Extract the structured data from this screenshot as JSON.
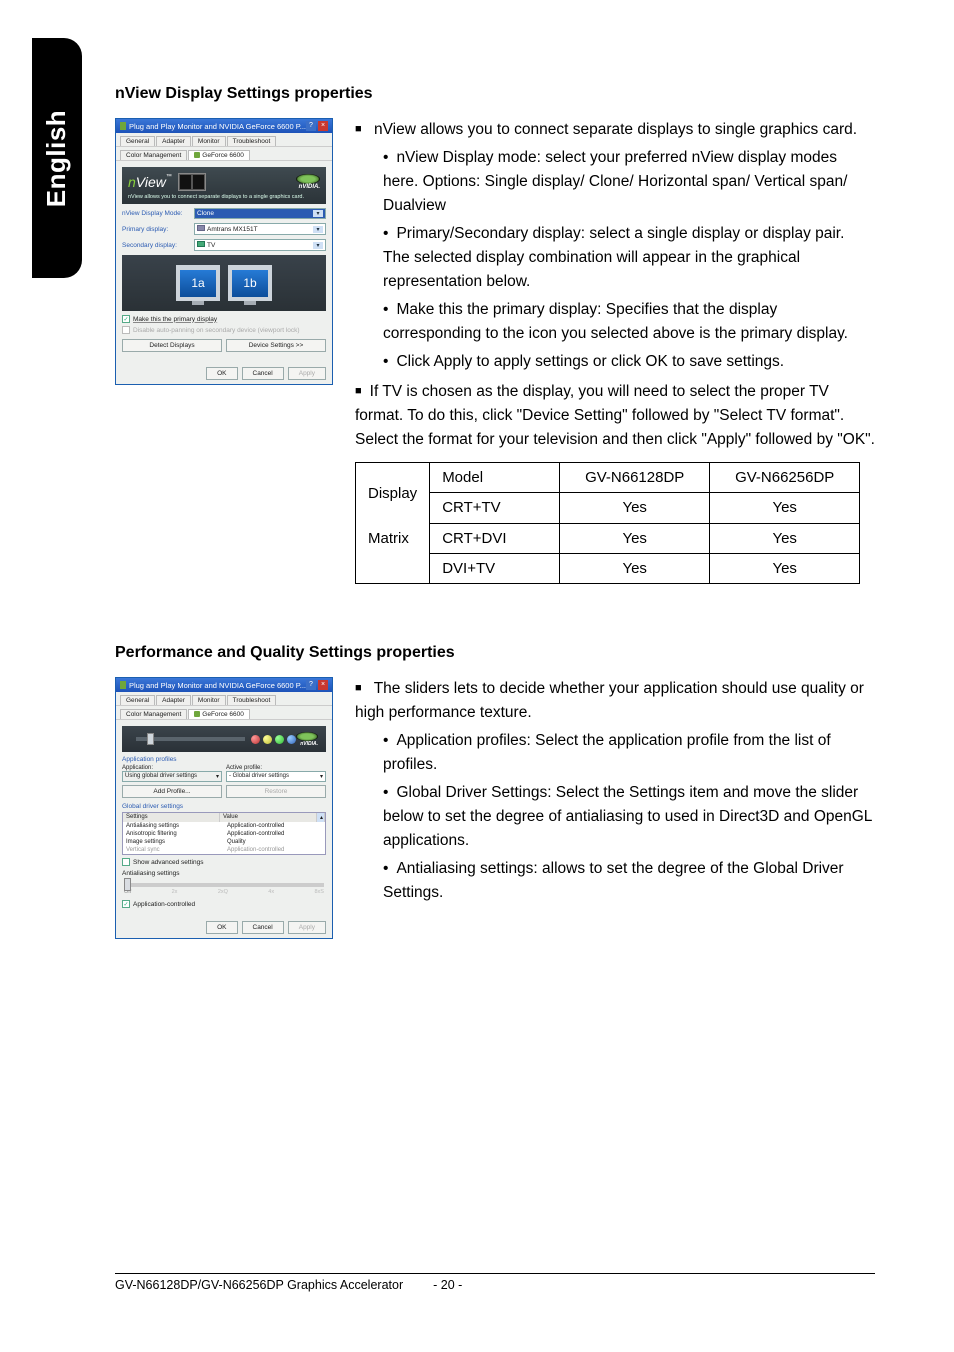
{
  "side_tab": "English",
  "sections": {
    "nview": {
      "heading": "nView Display Settings properties",
      "dialog": {
        "title": "Plug and Play Monitor and NVIDIA GeForce 6600 P...",
        "tabs_row1": [
          "General",
          "Adapter",
          "Monitor",
          "Troubleshoot"
        ],
        "tabs_row2": [
          "Color Management",
          "GeForce 6600"
        ],
        "banner_logo": {
          "prefix": "n",
          "rest": "View",
          "tm": "™"
        },
        "banner_brand": "nVIDIA.",
        "banner_caption": "nView allows you to connect separate displays to a single graphics card.",
        "rows": {
          "mode_label": "nView Display Mode:",
          "mode_value": "Clone",
          "primary_label": "Primary display:",
          "primary_value": "Amtrans MX151T",
          "secondary_label": "Secondary display:",
          "secondary_value": "TV"
        },
        "monitors": [
          "1a",
          "1b"
        ],
        "check1": "Make this the primary display",
        "check2": "Disable auto-panning on secondary device (viewport lock)",
        "btn_detect": "Detect Displays",
        "btn_device": "Device Settings >>",
        "footer": {
          "ok": "OK",
          "cancel": "Cancel",
          "apply": "Apply"
        }
      },
      "bullets": {
        "top1": "nView allows you to connect separate displays to single graphics card.",
        "sub1": "nView Display mode: select your preferred nView display modes here. Options: Single display/ Clone/ Horizontal span/ Vertical span/ Dualview",
        "sub2": "Primary/Secondary display: select a single display or display pair. The selected display combination will appear in the graphical representation below.",
        "sub3": "Make this the primary display: Specifies that the display corresponding to the icon you selected above is the primary display.",
        "sub4": "Click Apply to apply settings or click OK to save settings.",
        "top2": "If TV is chosen as the display,  you will need to select the proper TV format.  To do this, click \"Device Setting\" followed by \"Select TV format\". Select the format for your television and then click \"Apply\" followed by \"OK\"."
      },
      "table": {
        "h_display": "Display",
        "h_matrix": "Matrix",
        "h_model": "Model",
        "h_c1": "GV-N66128DP",
        "h_c2": "GV-N66256DP",
        "rows": [
          {
            "model": "CRT+TV",
            "c1": "Yes",
            "c2": "Yes"
          },
          {
            "model": "CRT+DVI",
            "c1": "Yes",
            "c2": "Yes"
          },
          {
            "model": "DVI+TV",
            "c1": "Yes",
            "c2": "Yes"
          }
        ]
      }
    },
    "perf": {
      "heading": "Performance and Quality Settings properties",
      "dialog": {
        "title": "Plug and Play Monitor and NVIDIA GeForce 6600 P...",
        "tabs_row1": [
          "General",
          "Adapter",
          "Monitor",
          "Troubleshoot"
        ],
        "tabs_row2": [
          "Color Management",
          "GeForce 6600"
        ],
        "brand": "nVIDIA.",
        "app_profiles_label": "Application profiles",
        "application_label": "Application:",
        "application_value": "Using global driver settings",
        "active_profile_label": "Active profile:",
        "active_profile_value": "- Global driver settings",
        "btn_add": "Add Profile...",
        "btn_restore": "Restore",
        "global_label": "Global driver settings",
        "list_headers": {
          "settings": "Settings",
          "value": "Value"
        },
        "list_rows": [
          {
            "s": "Antialiasing settings",
            "v": "Application-controlled"
          },
          {
            "s": "Anisotropic filtering",
            "v": "Application-controlled"
          },
          {
            "s": "Image settings",
            "v": "Quality"
          },
          {
            "s": "Vertical sync",
            "v": "Application-controlled"
          }
        ],
        "show_adv": "Show advanced settings",
        "aa_label": "Antialiasing settings",
        "aa_ticks": [
          "Off",
          "2x",
          "2xQ",
          "4x",
          "8xS"
        ],
        "aa_check": "Application-controlled",
        "footer": {
          "ok": "OK",
          "cancel": "Cancel",
          "apply": "Apply"
        }
      },
      "bullets": {
        "top1": "The sliders lets to decide whether your application should use quality or high performance texture.",
        "sub1": "Application profiles: Select the application profile from the list of profiles.",
        "sub2": "Global Driver Settings: Select the Settings item and move the slider below to set the degree of antialiasing to used in Direct3D and OpenGL applications.",
        "sub3": "Antialiasing settings: allows to set the degree of the Global Driver Settings."
      }
    }
  },
  "footer": {
    "left": "GV-N66128DP/GV-N66256DP Graphics Accelerator",
    "page": "- 20 -"
  }
}
